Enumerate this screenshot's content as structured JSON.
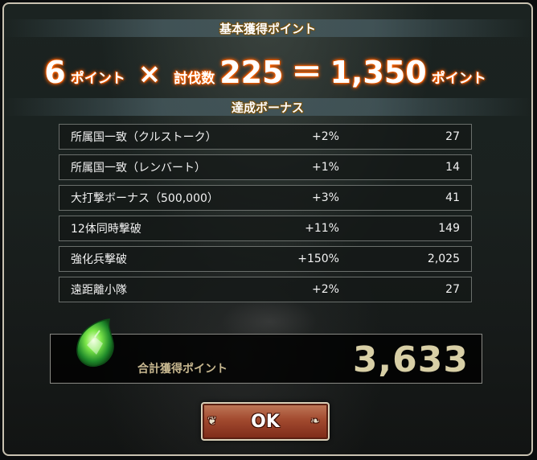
{
  "basic_title": "基本獲得ポイント",
  "formula": {
    "points": "6",
    "points_unit": "ポイント",
    "times": "×",
    "kills_label": "討伐数",
    "kills": "225",
    "equals": "＝",
    "result": "1,350",
    "result_unit": "ポイント"
  },
  "bonus_title": "達成ボーナス",
  "bonuses": [
    {
      "name": "所属国一致（クルストーク）",
      "pct": "+2%",
      "points": "27"
    },
    {
      "name": "所属国一致（レンバート）",
      "pct": "+1%",
      "points": "14"
    },
    {
      "name": "大打撃ボーナス（500,000）",
      "pct": "+3%",
      "points": "41"
    },
    {
      "name": "12体同時撃破",
      "pct": "+11%",
      "points": "149"
    },
    {
      "name": "強化兵撃破",
      "pct": "+150%",
      "points": "2,025"
    },
    {
      "name": "遠距離小隊",
      "pct": "+2%",
      "points": "27"
    }
  ],
  "total": {
    "label": "合計獲得ポイント",
    "value": "3,633",
    "icon": "green-gem-icon"
  },
  "ok_label": "OK",
  "colors": {
    "formula_glow": "#ff6a00",
    "total_value": "#d8cfa6",
    "ok_button": "#a24a2f"
  }
}
